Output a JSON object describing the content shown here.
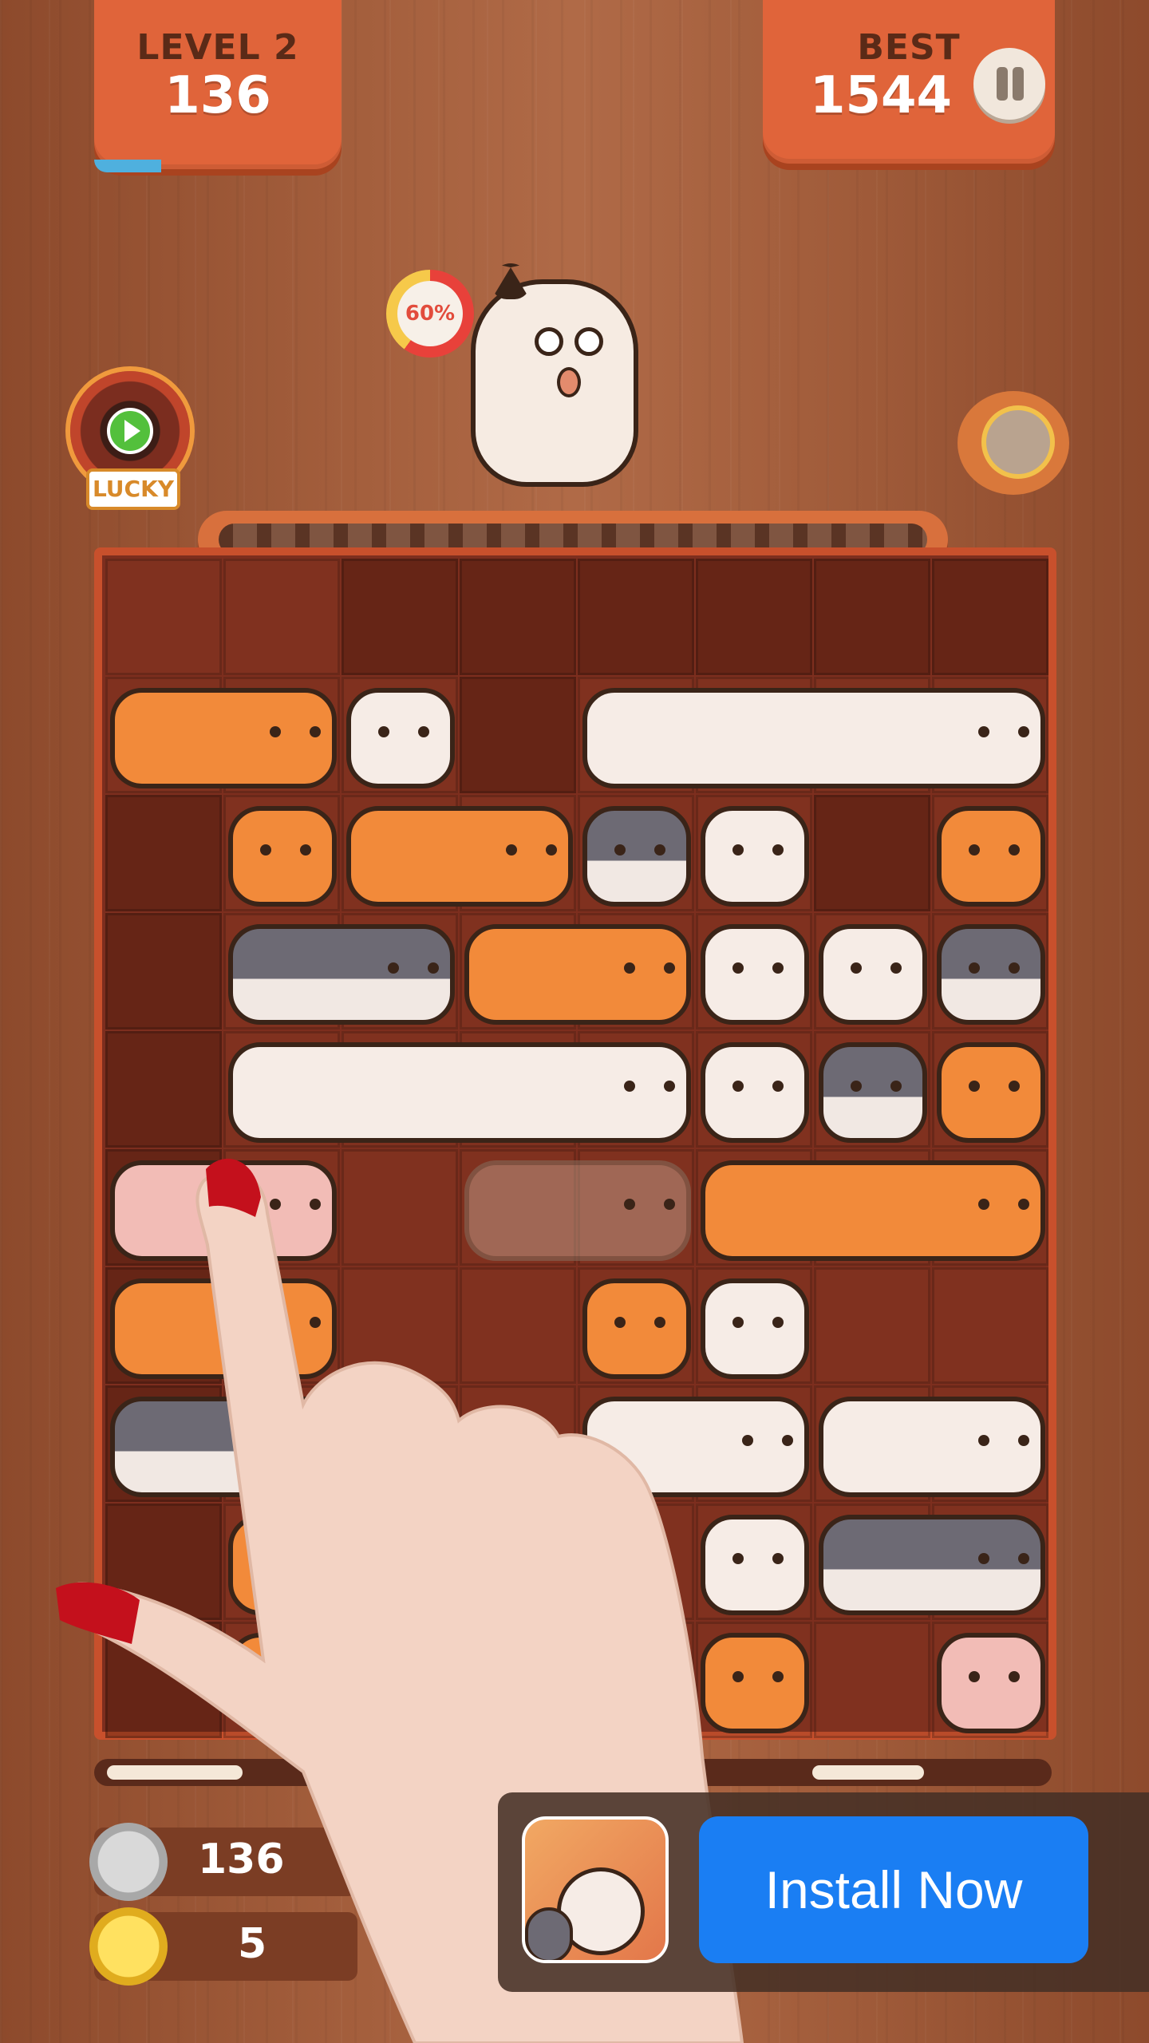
{
  "level_panel": {
    "label": "LEVEL 2",
    "score": "136",
    "progress": 0.27
  },
  "best_panel": {
    "label": "BEST",
    "score": "1544"
  },
  "rage_meter": {
    "percent_label": "60%",
    "value": 0.6
  },
  "lucky_wheel": {
    "label": "LUCKY"
  },
  "fish_counter": {
    "value": "136"
  },
  "coin_counter": {
    "value": "5"
  },
  "ad": {
    "button_label": "Install Now"
  },
  "colors": {
    "orange": "#f28a3a",
    "white": "#f6ece6",
    "gray": "#6d6a74",
    "pink": "#f2b6b3",
    "board": "#7d2e1e"
  },
  "board": {
    "cols": 8,
    "rows": 9,
    "cats": [
      {
        "row": 1,
        "col": 0,
        "span": 2,
        "color": "orange"
      },
      {
        "row": 1,
        "col": 2,
        "span": 1,
        "color": "white"
      },
      {
        "row": 1,
        "col": 4,
        "span": 4,
        "color": "white"
      },
      {
        "row": 2,
        "col": 1,
        "span": 1,
        "color": "orange"
      },
      {
        "row": 2,
        "col": 2,
        "span": 2,
        "color": "orange"
      },
      {
        "row": 2,
        "col": 4,
        "span": 1,
        "color": "gray"
      },
      {
        "row": 2,
        "col": 5,
        "span": 1,
        "color": "white"
      },
      {
        "row": 2,
        "col": 7,
        "span": 1,
        "color": "orange"
      },
      {
        "row": 3,
        "col": 1,
        "span": 2,
        "color": "gray"
      },
      {
        "row": 3,
        "col": 3,
        "span": 2,
        "color": "orange"
      },
      {
        "row": 3,
        "col": 5,
        "span": 1,
        "color": "white"
      },
      {
        "row": 3,
        "col": 6,
        "span": 1,
        "color": "white"
      },
      {
        "row": 3,
        "col": 7,
        "span": 1,
        "color": "gray"
      },
      {
        "row": 4,
        "col": 1,
        "span": 4,
        "color": "white"
      },
      {
        "row": 4,
        "col": 5,
        "span": 1,
        "color": "white"
      },
      {
        "row": 4,
        "col": 6,
        "span": 1,
        "color": "gray"
      },
      {
        "row": 4,
        "col": 7,
        "span": 1,
        "color": "orange"
      },
      {
        "row": 5,
        "col": 0,
        "span": 2,
        "color": "pink"
      },
      {
        "row": 5,
        "col": 3,
        "span": 2,
        "color": "ghost"
      },
      {
        "row": 5,
        "col": 5,
        "span": 3,
        "color": "orange"
      },
      {
        "row": 6,
        "col": 0,
        "span": 2,
        "color": "orange"
      },
      {
        "row": 6,
        "col": 4,
        "span": 1,
        "color": "orange"
      },
      {
        "row": 6,
        "col": 5,
        "span": 1,
        "color": "white"
      },
      {
        "row": 7,
        "col": 0,
        "span": 3,
        "color": "gray"
      },
      {
        "row": 7,
        "col": 4,
        "span": 2,
        "color": "white"
      },
      {
        "row": 7,
        "col": 6,
        "span": 2,
        "color": "white"
      },
      {
        "row": 8,
        "col": 1,
        "span": 1,
        "color": "orange"
      },
      {
        "row": 8,
        "col": 5,
        "span": 1,
        "color": "white"
      },
      {
        "row": 8,
        "col": 6,
        "span": 2,
        "color": "gray"
      },
      {
        "row": 9,
        "col": 1,
        "span": 1,
        "color": "orange"
      },
      {
        "row": 9,
        "col": 5,
        "span": 1,
        "color": "orange"
      },
      {
        "row": 9,
        "col": 7,
        "span": 1,
        "color": "pink"
      }
    ]
  }
}
